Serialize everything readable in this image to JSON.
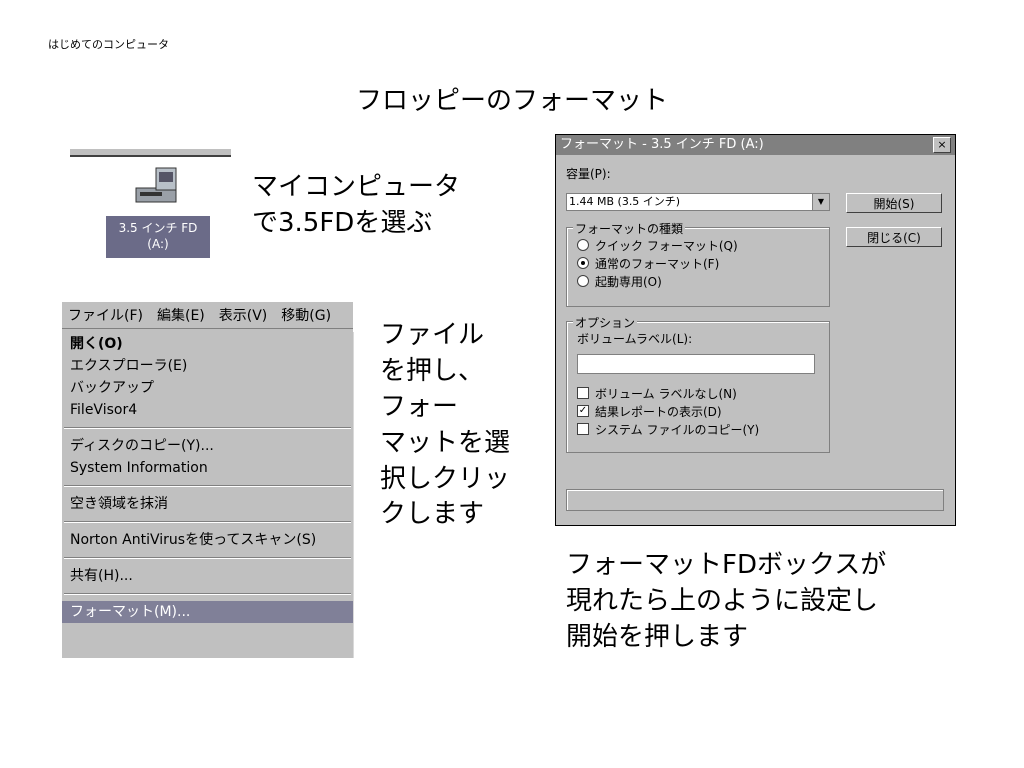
{
  "header_text": "はじめてのコンピュータ",
  "slide_title": "フロッピーのフォーマット",
  "drive": {
    "icon": "floppy-drive-icon",
    "label_line1": "3.5 インチ FD",
    "label_line2": "(A:)"
  },
  "captions": {
    "mycomputer_line1": "マイコンピュータ",
    "mycomputer_line2": "で3.5FDを選ぶ",
    "file_lines": [
      "ファイル",
      "を押し、",
      "フォー",
      "マットを選",
      "択しクリッ",
      "クします"
    ],
    "format_lines": [
      "フォーマットFDボックスが",
      "現れたら上のように設定し",
      "開始を押します"
    ]
  },
  "menu": {
    "bar": [
      "ファイル(F)",
      "編集(E)",
      "表示(V)",
      "移動(G)"
    ],
    "items": [
      "開く(O)",
      "エクスプローラ(E)",
      "バックアップ",
      "FileVisor4",
      "ディスクのコピー(Y)...",
      "System Information",
      "空き領域を抹消",
      "Norton AntiVirusを使ってスキャン(S)",
      "共有(H)...",
      "フォーマット(M)..."
    ]
  },
  "dialog": {
    "title": "フォーマット - 3.5 インチ FD (A:)",
    "close": "×",
    "capacity_label": "容量(P):",
    "capacity_value": "1.44 MB (3.5 インチ)",
    "dropdown_arrow": "▼",
    "start_button": "開始(S)",
    "close_button": "閉じる(C)",
    "format_type_label": "フォーマットの種類",
    "format_types": [
      "クイック フォーマット(Q)",
      "通常のフォーマット(F)",
      "起動専用(O)"
    ],
    "options_label": "オプション",
    "volume_label": "ボリュームラベル(L):",
    "volume_value": "",
    "options": [
      "ボリューム ラベルなし(N)",
      "結果レポートの表示(D)",
      "システム ファイルのコピー(Y)"
    ],
    "checkmark": "✓"
  }
}
